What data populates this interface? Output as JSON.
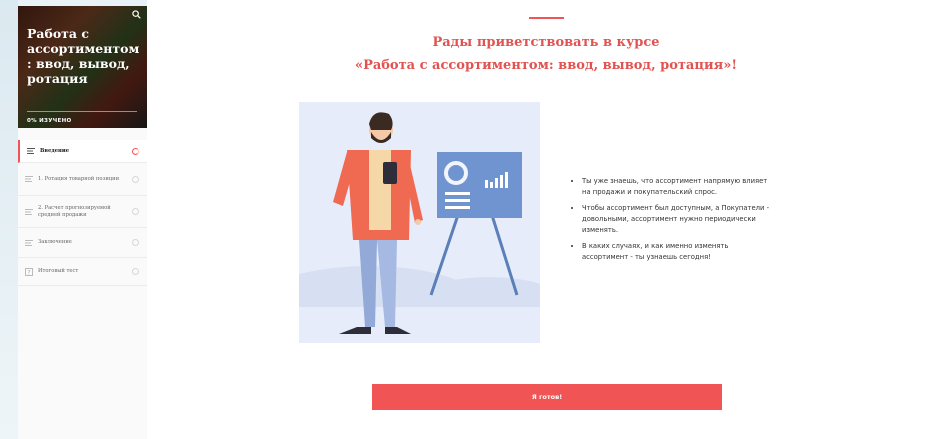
{
  "sidebar": {
    "course_title": "Работа с ассортиментом : ввод, вывод, ротация",
    "progress_text": "0% ИЗУЧЕНО",
    "items": [
      {
        "label": "Введение",
        "icon": "lines-icon"
      },
      {
        "label": "1. Ротация товарной позиции",
        "icon": "lines-icon"
      },
      {
        "label": "2. Расчет прогнозируемой средней продажи",
        "icon": "lines-icon"
      },
      {
        "label": "Заключение",
        "icon": "lines-icon"
      },
      {
        "label": "Итоговый тест",
        "icon": "quiz-icon"
      }
    ]
  },
  "main": {
    "welcome_line1": "Рады приветствовать в курсе",
    "welcome_line2": "«Работа с ассортиментом: ввод, вывод, ротация»!",
    "bullets": [
      "Ты уже знаешь, что ассортимент напрямую влияет на продажи и покупательский спрос.",
      "Чтобы ассортимент был доступным, а Покупатели - довольными, ассортимент нужно периодически изменять.",
      "В каких случаях, и как именно изменять ассортимент - ты узнаешь сегодня!"
    ],
    "ready_button": "Я готов!"
  },
  "colors": {
    "accent": "#f05454",
    "title": "#e25250",
    "illustration_bg": "#e6ecf9",
    "board": "#6f94cf"
  }
}
